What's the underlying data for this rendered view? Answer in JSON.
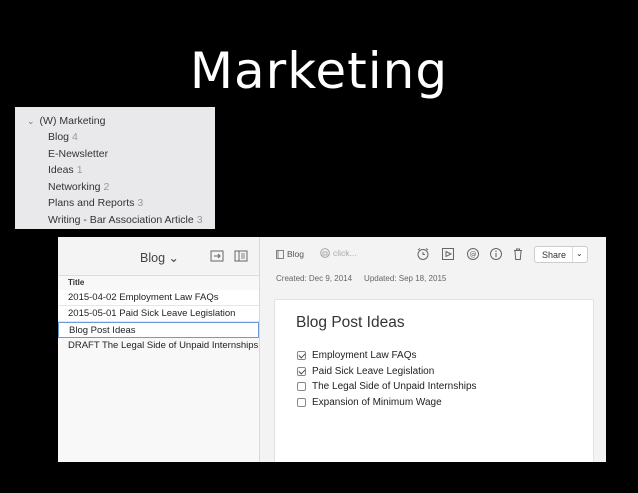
{
  "slide": {
    "title": "Marketing"
  },
  "notebooks": {
    "parent": "(W) Marketing",
    "items": [
      {
        "name": "Blog",
        "count": "4"
      },
      {
        "name": "E-Newsletter",
        "count": ""
      },
      {
        "name": "Ideas",
        "count": "1"
      },
      {
        "name": "Networking",
        "count": "2"
      },
      {
        "name": "Plans and Reports",
        "count": "3"
      },
      {
        "name": "Writing - Bar Association Article",
        "count": "3"
      }
    ]
  },
  "note_list": {
    "title": "Blog ⌄",
    "column_header": "Title",
    "notes": [
      "2015-04-02 Employment Law FAQs",
      "2015-05-01 Paid Sick Leave Legislation",
      "Blog Post Ideas",
      "DRAFT The Legal Side of Unpaid Internships"
    ]
  },
  "editor": {
    "notebook": "Blog",
    "tag_placeholder": "click...",
    "share_label": "Share",
    "created": "Created: Dec 9, 2014",
    "updated": "Updated: Sep 18, 2015",
    "note_title": "Blog Post Ideas",
    "checklist": [
      {
        "text": "Employment Law FAQs",
        "checked": true
      },
      {
        "text": "Paid Sick Leave Legislation",
        "checked": true
      },
      {
        "text": "The Legal Side of Unpaid Internships",
        "checked": false
      },
      {
        "text": "Expansion of Minimum Wage",
        "checked": false
      }
    ]
  }
}
